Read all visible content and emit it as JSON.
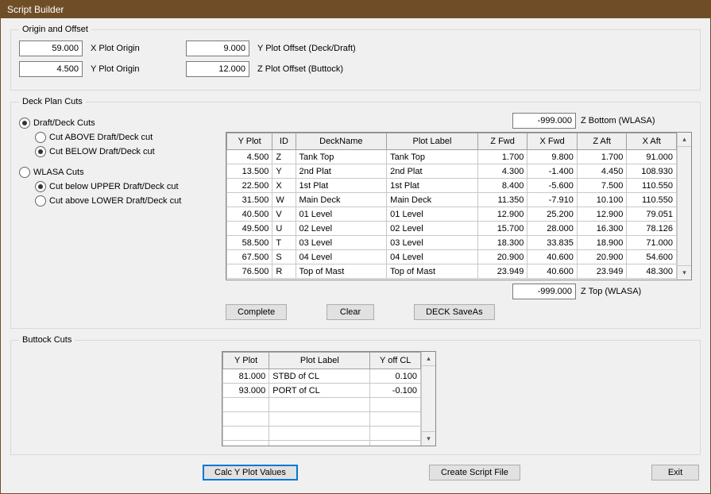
{
  "window": {
    "title": "Script Builder"
  },
  "origin": {
    "legend": "Origin and Offset",
    "x_plot_origin": "59.000",
    "x_plot_origin_label": "X Plot Origin",
    "y_plot_origin": "4.500",
    "y_plot_origin_label": "Y Plot Origin",
    "y_offset": "9.000",
    "y_offset_label": "Y Plot Offset (Deck/Draft)",
    "z_offset": "12.000",
    "z_offset_label": "Z Plot Offset (Buttock)"
  },
  "deck": {
    "legend": "Deck Plan Cuts",
    "radios": {
      "draft_deck": "Draft/Deck Cuts",
      "cut_above": "Cut ABOVE Draft/Deck cut",
      "cut_below": "Cut BELOW Draft/Deck cut",
      "wlasa": "WLASA Cuts",
      "cut_below_upper": "Cut below UPPER Draft/Deck cut",
      "cut_above_lower": "Cut above LOWER Draft/Deck cut"
    },
    "z_bottom_val": "-999.000",
    "z_bottom_label": "Z Bottom (WLASA)",
    "z_top_val": "-999.000",
    "z_top_label": "Z Top (WLASA)",
    "headers": {
      "yplot": "Y Plot",
      "id": "ID",
      "deckname": "DeckName",
      "plotlabel": "Plot Label",
      "zfwd": "Z Fwd",
      "xfwd": "X Fwd",
      "zaft": "Z Aft",
      "xaft": "X Aft"
    },
    "rows": [
      {
        "yplot": "4.500",
        "id": "Z",
        "name": "Tank Top",
        "label": "Tank Top",
        "zfwd": "1.700",
        "xfwd": "9.800",
        "zaft": "1.700",
        "xaft": "91.000"
      },
      {
        "yplot": "13.500",
        "id": "Y",
        "name": "2nd Plat",
        "label": "2nd Plat",
        "zfwd": "4.300",
        "xfwd": "-1.400",
        "zaft": "4.450",
        "xaft": "108.930"
      },
      {
        "yplot": "22.500",
        "id": "X",
        "name": "1st Plat",
        "label": "1st Plat",
        "zfwd": "8.400",
        "xfwd": "-5.600",
        "zaft": "7.500",
        "xaft": "110.550"
      },
      {
        "yplot": "31.500",
        "id": "W",
        "name": "Main Deck",
        "label": "Main Deck",
        "zfwd": "11.350",
        "xfwd": "-7.910",
        "zaft": "10.100",
        "xaft": "110.550"
      },
      {
        "yplot": "40.500",
        "id": "V",
        "name": "01 Level",
        "label": "01 Level",
        "zfwd": "12.900",
        "xfwd": "25.200",
        "zaft": "12.900",
        "xaft": "79.051"
      },
      {
        "yplot": "49.500",
        "id": "U",
        "name": "02 Level",
        "label": "02 Level",
        "zfwd": "15.700",
        "xfwd": "28.000",
        "zaft": "16.300",
        "xaft": "78.126"
      },
      {
        "yplot": "58.500",
        "id": "T",
        "name": "03 Level",
        "label": "03 Level",
        "zfwd": "18.300",
        "xfwd": "33.835",
        "zaft": "18.900",
        "xaft": "71.000"
      },
      {
        "yplot": "67.500",
        "id": "S",
        "name": "04 Level",
        "label": "04 Level",
        "zfwd": "20.900",
        "xfwd": "40.600",
        "zaft": "20.900",
        "xaft": "54.600"
      },
      {
        "yplot": "76.500",
        "id": "R",
        "name": "Top of Mast",
        "label": "Top of Mast",
        "zfwd": "23.949",
        "xfwd": "40.600",
        "zaft": "23.949",
        "xaft": "48.300"
      }
    ],
    "buttons": {
      "complete": "Complete",
      "clear": "Clear",
      "saveas": "DECK SaveAs"
    }
  },
  "buttock": {
    "legend": "Buttock Cuts",
    "headers": {
      "yplot": "Y Plot",
      "plotlabel": "Plot Label",
      "yoffcl": "Y off CL"
    },
    "rows": [
      {
        "yplot": "81.000",
        "label": "STBD of CL",
        "yoff": "0.100"
      },
      {
        "yplot": "93.000",
        "label": "PORT of CL",
        "yoff": "-0.100"
      },
      {
        "yplot": "",
        "label": "",
        "yoff": ""
      },
      {
        "yplot": "",
        "label": "",
        "yoff": ""
      },
      {
        "yplot": "",
        "label": "",
        "yoff": ""
      },
      {
        "yplot": "",
        "label": "",
        "yoff": ""
      }
    ]
  },
  "footer": {
    "calc": "Calc Y Plot Values",
    "create": "Create Script File",
    "exit": "Exit"
  }
}
